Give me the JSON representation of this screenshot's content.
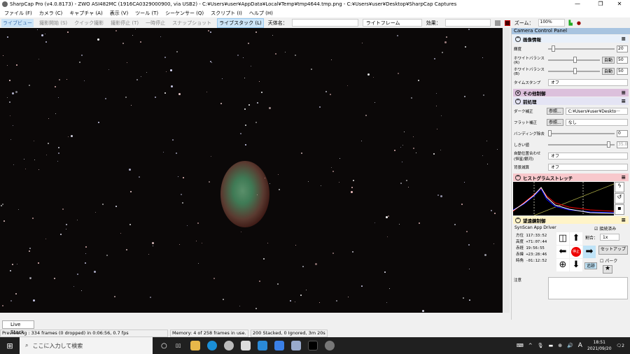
{
  "title": "SharpCap Pro (v4.0.8173) - ZWO ASI482MC (1916CA0329000900, via USB2) - C:¥Users¥user¥AppData¥Local¥Temp¥tmp4644.tmp.png - C:¥Users¥user¥Desktop¥SharpCap Captures",
  "window": {
    "minimize": "—",
    "maximize": "❐",
    "close": "✕"
  },
  "menu": [
    "ファイル (F)",
    "カメラ (C)",
    "キャプチャ (A)",
    "表示 (V)",
    "ツール (T)",
    "シーケンサー (Q)",
    "スクリプト (I)",
    "ヘルプ (H)"
  ],
  "toolbar": {
    "live_view": "ライブビュー",
    "start_capture": "撮影開始 (S)",
    "quick_capture": "クイック撮影",
    "stop_capture": "撮影停止 (T)",
    "pause": "一時停止",
    "snapshot": "スナップショット",
    "live_stack": "ライブスタック (L)",
    "target_label": "天体名：",
    "target_value": "",
    "frame_type": "ライトフレーム",
    "effect_label": "効果：",
    "effect_value": "",
    "zoom_label": "ズーム：",
    "zoom_value": "100%"
  },
  "panel": {
    "title": "Camera Control Panel",
    "image_info": {
      "title": "画像情報",
      "brightness_label": "輝度",
      "brightness": "20",
      "brightness_pos": 0.05,
      "wb_r_label": "ホワイトバランス(R)",
      "wb_r": "50",
      "wb_b_label": "ホワイトバランス(B)",
      "wb_b": "50",
      "auto": "自動",
      "timestamp_label": "タイムスタンプ",
      "timestamp": "オフ"
    },
    "other": {
      "title": "その他制御"
    },
    "preprocess": {
      "title": "前処理",
      "dark_label": "ダーク補正",
      "dark_value": "C:¥Users¥user¥Deskto···",
      "browse": "参照...",
      "flat_label": "フラット補正",
      "flat_value": "なし",
      "banding_label": "バンディング除去",
      "banding": "0",
      "threshold_label": "しきい値",
      "threshold": "35.0",
      "align_label": "自動位置合わせ (恒星/銀河)",
      "align": "オフ",
      "bg_label": "背景減算",
      "bg": "オフ"
    },
    "histogram": {
      "title": "ヒストグラムストレッチ"
    },
    "mount": {
      "title": "望遠鏡制御",
      "driver": "SynScan App Driver",
      "connected": "接続済み",
      "rate_label": "割合：",
      "rate": "1x",
      "setup": "セットアップ",
      "park": "パーク",
      "stop": "停止",
      "track": "追跡",
      "az_label": "方位",
      "az": "117:33:52",
      "alt_label": "高度",
      "alt": "+71:07:44",
      "ra_label": "赤経",
      "ra": "19:56:55",
      "dec_label": "赤緯",
      "dec": "+23:28:46",
      "ha_label": "時角",
      "ha": "-01:12:52",
      "notes_label": "注意"
    }
  },
  "tab": "Live Stack",
  "status": {
    "preview": "Previewing : 334 frames (0 dropped) in 0:06:56, 0.7 fps",
    "memory": "Memory: 4 of 258 frames in use.",
    "stack": "200 Stacked, 0 Ignored, 3m 20s"
  },
  "taskbar": {
    "search": "ここに入力して検索",
    "time": "18:51",
    "date": "2021/09/20",
    "ime": "A",
    "notifications": "2"
  }
}
